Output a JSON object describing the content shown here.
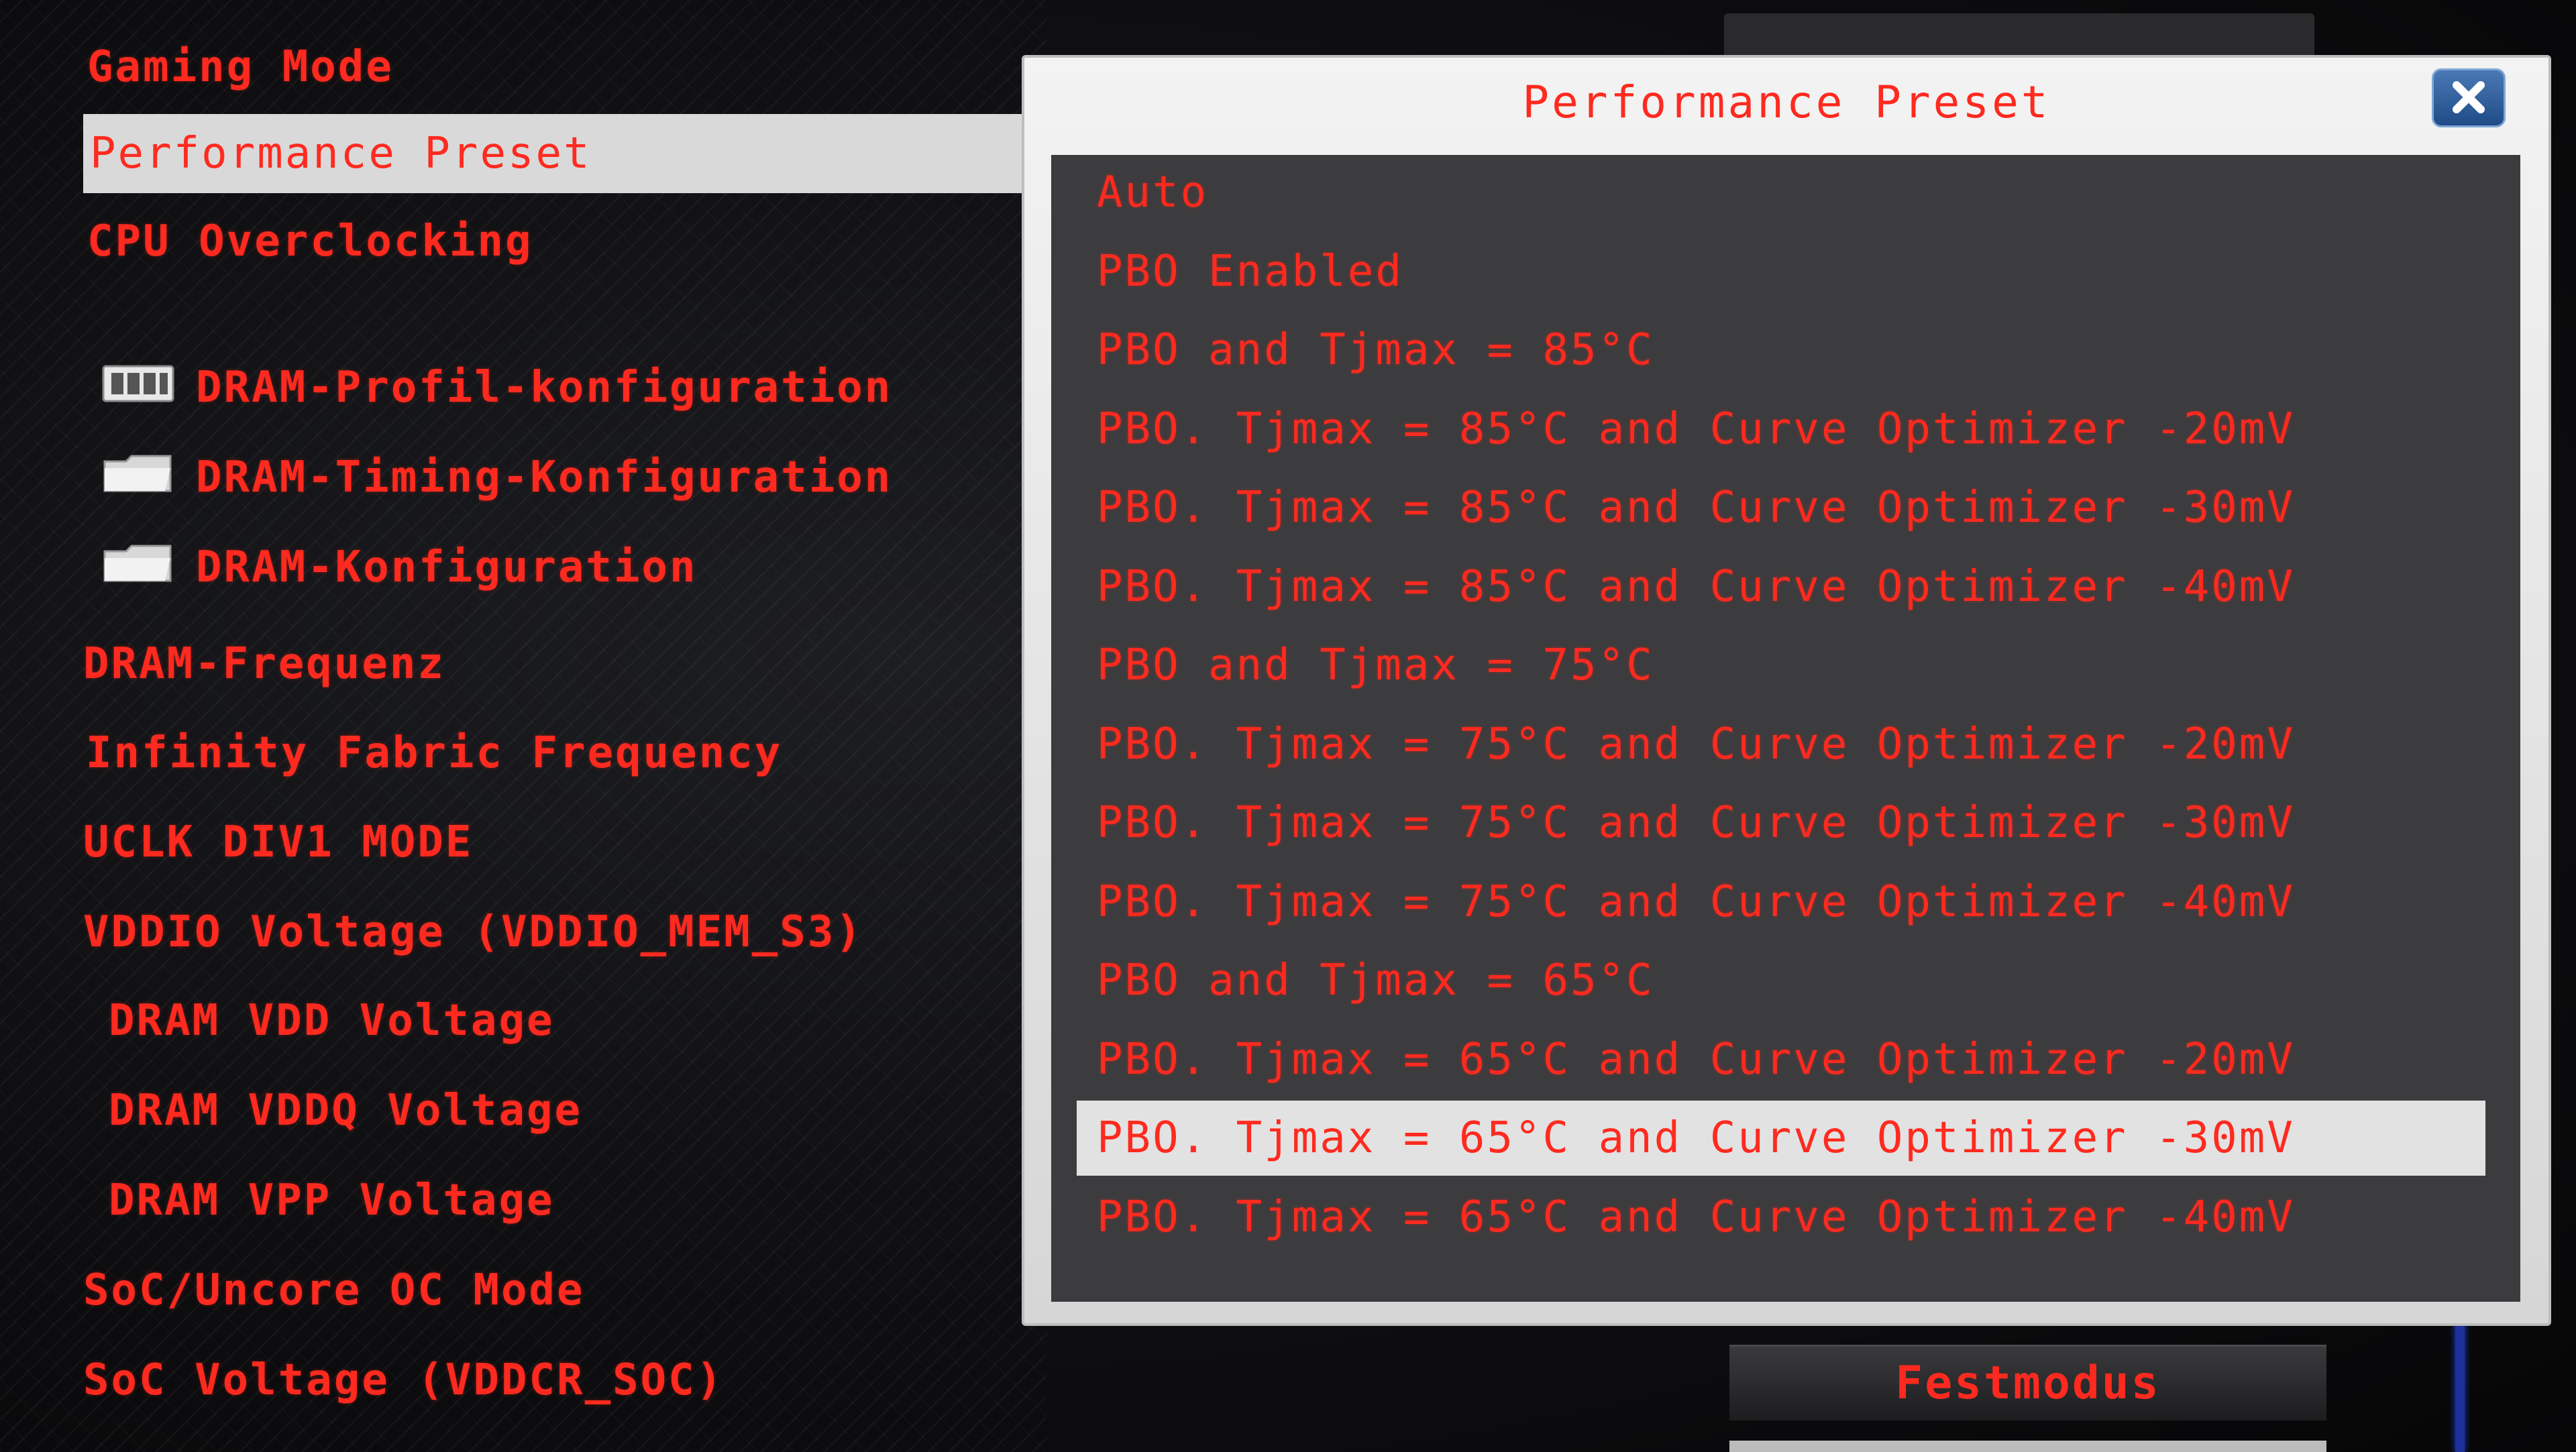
{
  "left_menu": {
    "gaming_mode": "Gaming Mode",
    "performance_preset": "Performance Preset",
    "cpu_overclocking": "CPU Overclocking",
    "dram_profile_config": "DRAM-Profil-konfiguration",
    "dram_timing_config": "DRAM-Timing-Konfiguration",
    "dram_config": "DRAM-Konfiguration",
    "dram_frequency": "DRAM-Frequenz",
    "infinity_fabric_frequency": "Infinity Fabric Frequency",
    "uclk_div1_mode": "UCLK DIV1 MODE",
    "vddio_voltage": "VDDIO Voltage (VDDIO_MEM_S3)",
    "dram_vdd_voltage": "DRAM VDD Voltage",
    "dram_vddq_voltage": "DRAM VDDQ Voltage",
    "dram_vpp_voltage": "DRAM VPP Voltage",
    "soc_uncore_oc_mode": "SoC/Uncore OC Mode",
    "soc_voltage": "SoC Voltage (VDDCR_SOC)"
  },
  "dialog": {
    "title": "Performance Preset",
    "close_icon": "close-x-icon",
    "selected_index": 12,
    "options": [
      "Auto",
      "PBO Enabled",
      "PBO and Tjmax = 85°C",
      "PBO. Tjmax = 85°C and Curve Optimizer -20mV",
      "PBO. Tjmax = 85°C and Curve Optimizer -30mV",
      "PBO. Tjmax = 85°C and Curve Optimizer -40mV",
      "PBO and Tjmax = 75°C",
      "PBO. Tjmax = 75°C and Curve Optimizer -20mV",
      "PBO. Tjmax = 75°C and Curve Optimizer -30mV",
      "PBO. Tjmax = 75°C and Curve Optimizer -40mV",
      "PBO and Tjmax = 65°C",
      "PBO. Tjmax = 65°C and Curve Optimizer -20mV",
      "PBO. Tjmax = 65°C and Curve Optimizer -30mV",
      "PBO. Tjmax = 65°C and Curve Optimizer -40mV"
    ]
  },
  "right_panel": {
    "fixed_mode_button": "Festmodus"
  },
  "colors": {
    "accent_red": "#ff2a1f",
    "selection_bg": "#e2e2e2",
    "list_bg": "#3c3c3e",
    "close_button_blue": "#2f62a3"
  }
}
